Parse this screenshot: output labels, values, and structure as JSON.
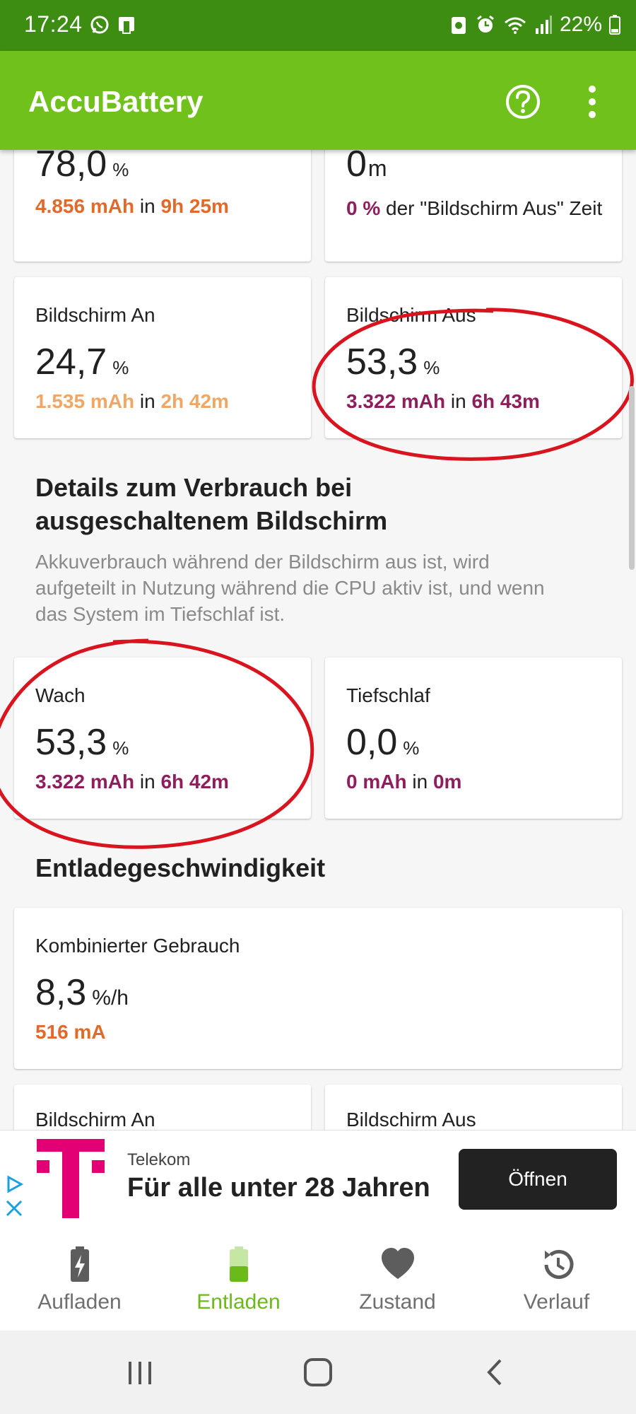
{
  "status_bar": {
    "time": "17:24",
    "battery_percent": "22%"
  },
  "app_bar": {
    "title": "AccuBattery"
  },
  "top_cards": {
    "left": {
      "value": "78,0",
      "unit": "%",
      "mah": "4.856 mAh",
      "in_word": "in",
      "duration": "9h 25m"
    },
    "right": {
      "value": "0",
      "unit": "m",
      "pct": "0 %",
      "text": "der \"Bildschirm Aus\" Zeit"
    }
  },
  "screen_cards": {
    "on": {
      "label": "Bildschirm An",
      "value": "24,7",
      "unit": "%",
      "mah": "1.535 mAh",
      "in_word": "in",
      "duration": "2h 42m"
    },
    "off": {
      "label": "Bildschirm Aus",
      "value": "53,3",
      "unit": "%",
      "mah": "3.322 mAh",
      "in_word": "in",
      "duration": "6h 43m"
    }
  },
  "details_section": {
    "title": "Details zum Verbrauch bei ausgeschaltenem Bildschirm",
    "description": "Akkuverbrauch während der Bildschirm aus ist, wird aufgeteilt in Nutzung während die CPU aktiv ist, und wenn das System im Tiefschlaf ist."
  },
  "sleep_cards": {
    "awake": {
      "label": "Wach",
      "value": "53,3",
      "unit": "%",
      "mah": "3.322 mAh",
      "in_word": "in",
      "duration": "6h 42m"
    },
    "deep_sleep": {
      "label": "Tiefschlaf",
      "value": "0,0",
      "unit": "%",
      "mah": "0 mAh",
      "in_word": "in",
      "duration": "0m"
    }
  },
  "discharge_section": {
    "title": "Entladegeschwindigkeit"
  },
  "combined_card": {
    "label": "Kombinierter Gebrauch",
    "value": "8,3",
    "unit": "%/h",
    "current": "516 mA"
  },
  "partial_cards": {
    "left_label": "Bildschirm An",
    "right_label": "Bildschirm Aus"
  },
  "ad": {
    "advertiser": "Telekom",
    "headline": "Für alle unter 28 Jahren",
    "cta": "Öffnen"
  },
  "bottom_nav": {
    "items": [
      {
        "label": "Aufladen"
      },
      {
        "label": "Entladen"
      },
      {
        "label": "Zustand"
      },
      {
        "label": "Verlauf"
      }
    ],
    "active_index": 1
  },
  "colors": {
    "status_bar": "#3c8d12",
    "app_bar": "#71c11d",
    "accent_orange": "#e06a2c",
    "accent_light_orange": "#f0a766",
    "accent_purple": "#8e1e5c",
    "annotation_red": "#d9141e",
    "telekom_magenta": "#e20074"
  }
}
